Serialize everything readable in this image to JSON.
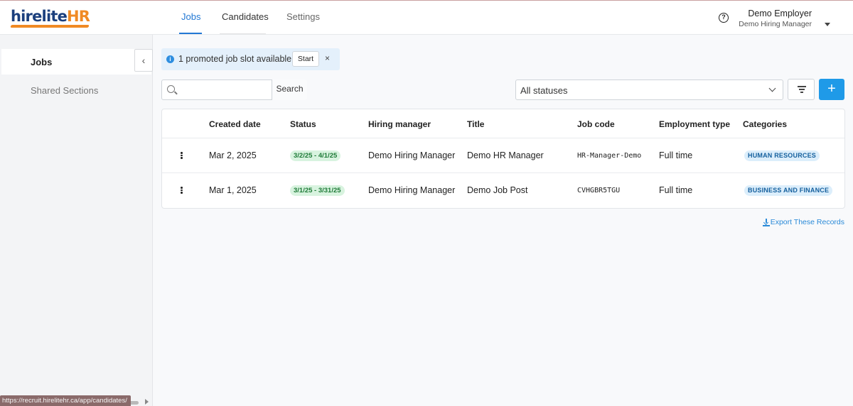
{
  "brand": {
    "logo_part1": "hirelite",
    "logo_part2": "HR",
    "accent": "#f08a24",
    "primary": "#1b3f7d"
  },
  "nav": {
    "tabs": [
      "Jobs",
      "Candidates",
      "Settings"
    ],
    "active": "Jobs"
  },
  "user": {
    "name": "Demo Employer",
    "role": "Demo Hiring Manager"
  },
  "sidebar": {
    "items": [
      {
        "label": "Jobs",
        "active": true
      },
      {
        "label": "Shared Sections",
        "active": false
      }
    ]
  },
  "promo": {
    "text": "1 promoted job slot available",
    "start_label": "Start",
    "close_label": "×"
  },
  "search": {
    "placeholder": "",
    "button_label": "Search"
  },
  "filters": {
    "status_value": "All statuses"
  },
  "table": {
    "headers": [
      "Created date",
      "Status",
      "Hiring manager",
      "Title",
      "Job code",
      "Employment type",
      "Categories"
    ],
    "rows": [
      {
        "created": "Mar 2, 2025",
        "status": "3/2/25 - 4/1/25",
        "manager": "Demo Hiring Manager",
        "title": "Demo HR Manager",
        "code": "HR-Manager-Demo",
        "type": "Full time",
        "category": "HUMAN RESOURCES"
      },
      {
        "created": "Mar 1, 2025",
        "status": "3/1/25 - 3/31/25",
        "manager": "Demo Hiring Manager",
        "title": "Demo Job Post",
        "code": "CVHGBR5TGU",
        "type": "Full time",
        "category": "BUSINESS AND FINANCE"
      }
    ]
  },
  "export": {
    "label": "Export These Records"
  },
  "browser_status": {
    "url": "https://recruit.hirelitehr.ca/app/candidates/"
  }
}
